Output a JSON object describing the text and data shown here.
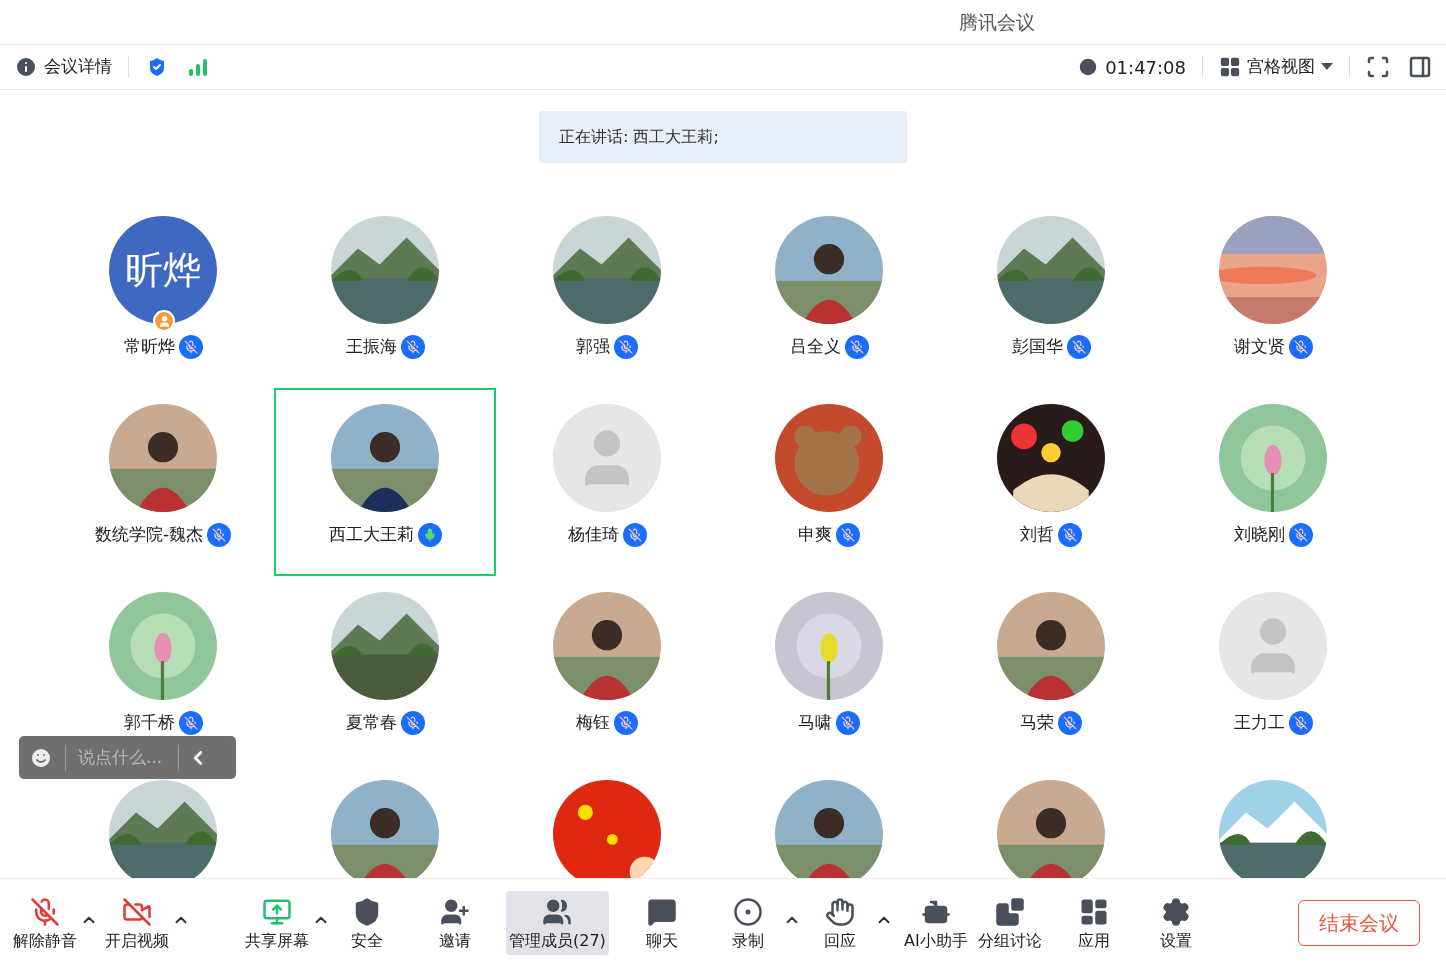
{
  "window": {
    "title": "腾讯会议"
  },
  "header": {
    "details": "会议详情",
    "timer": "01:47:08",
    "view": "宫格视图"
  },
  "speaking": "正在讲话: 西工大王莉;",
  "participants": [
    {
      "name": "常昕烨",
      "muted": true,
      "selected": false,
      "host": true,
      "avatar": {
        "kind": "initials",
        "text": "昕烨"
      }
    },
    {
      "name": "王振海",
      "muted": true,
      "selected": false,
      "avatar": {
        "kind": "picture"
      }
    },
    {
      "name": "郭强",
      "muted": true,
      "selected": false,
      "avatar": {
        "kind": "picture"
      }
    },
    {
      "name": "吕全义",
      "muted": true,
      "selected": false,
      "avatar": {
        "kind": "picture"
      }
    },
    {
      "name": "彭国华",
      "muted": true,
      "selected": false,
      "avatar": {
        "kind": "picture"
      }
    },
    {
      "name": "谢文贤",
      "muted": true,
      "selected": false,
      "avatar": {
        "kind": "picture"
      }
    },
    {
      "name": "数统学院-魏杰",
      "muted": true,
      "selected": false,
      "avatar": {
        "kind": "picture"
      }
    },
    {
      "name": "西工大王莉",
      "muted": false,
      "selected": true,
      "avatar": {
        "kind": "picture"
      }
    },
    {
      "name": "杨佳琦",
      "muted": true,
      "selected": false,
      "avatar": {
        "kind": "default"
      }
    },
    {
      "name": "申爽",
      "muted": true,
      "selected": false,
      "avatar": {
        "kind": "picture"
      }
    },
    {
      "name": "刘哲",
      "muted": true,
      "selected": false,
      "avatar": {
        "kind": "picture"
      }
    },
    {
      "name": "刘晓刚",
      "muted": true,
      "selected": false,
      "avatar": {
        "kind": "picture"
      }
    },
    {
      "name": "郭千桥",
      "muted": true,
      "selected": false,
      "avatar": {
        "kind": "picture"
      }
    },
    {
      "name": "夏常春",
      "muted": true,
      "selected": false,
      "avatar": {
        "kind": "picture"
      }
    },
    {
      "name": "梅钰",
      "muted": true,
      "selected": false,
      "avatar": {
        "kind": "picture"
      }
    },
    {
      "name": "马啸",
      "muted": true,
      "selected": false,
      "avatar": {
        "kind": "picture"
      }
    },
    {
      "name": "马荣",
      "muted": true,
      "selected": false,
      "avatar": {
        "kind": "picture"
      }
    },
    {
      "name": "王力工",
      "muted": true,
      "selected": false,
      "avatar": {
        "kind": "default"
      }
    },
    {
      "avatar": {
        "kind": "picture"
      }
    },
    {
      "avatar": {
        "kind": "picture"
      }
    },
    {
      "avatar": {
        "kind": "picture"
      }
    },
    {
      "avatar": {
        "kind": "picture"
      }
    },
    {
      "avatar": {
        "kind": "picture"
      }
    },
    {
      "avatar": {
        "kind": "picture"
      }
    }
  ],
  "chat": {
    "placeholder": "说点什么..."
  },
  "toolbar": [
    {
      "label": "解除静音",
      "menu": true,
      "selected": false
    },
    {
      "label": "开启视频",
      "menu": true,
      "selected": false
    },
    {
      "label": "共享屏幕",
      "menu": true,
      "selected": false
    },
    {
      "label": "安全",
      "menu": false,
      "selected": false
    },
    {
      "label": "邀请",
      "menu": false,
      "selected": false
    },
    {
      "label": "管理成员(27)",
      "menu": false,
      "selected": true
    },
    {
      "label": "聊天",
      "menu": false,
      "selected": false
    },
    {
      "label": "录制",
      "menu": true,
      "selected": false
    },
    {
      "label": "回应",
      "menu": true,
      "selected": false
    },
    {
      "label": "AI小助手",
      "menu": false,
      "selected": false
    },
    {
      "label": "分组讨论",
      "menu": false,
      "selected": false
    },
    {
      "label": "应用",
      "menu": false,
      "selected": false
    },
    {
      "label": "设置",
      "menu": false,
      "selected": false
    }
  ],
  "end_button": "结束会议"
}
